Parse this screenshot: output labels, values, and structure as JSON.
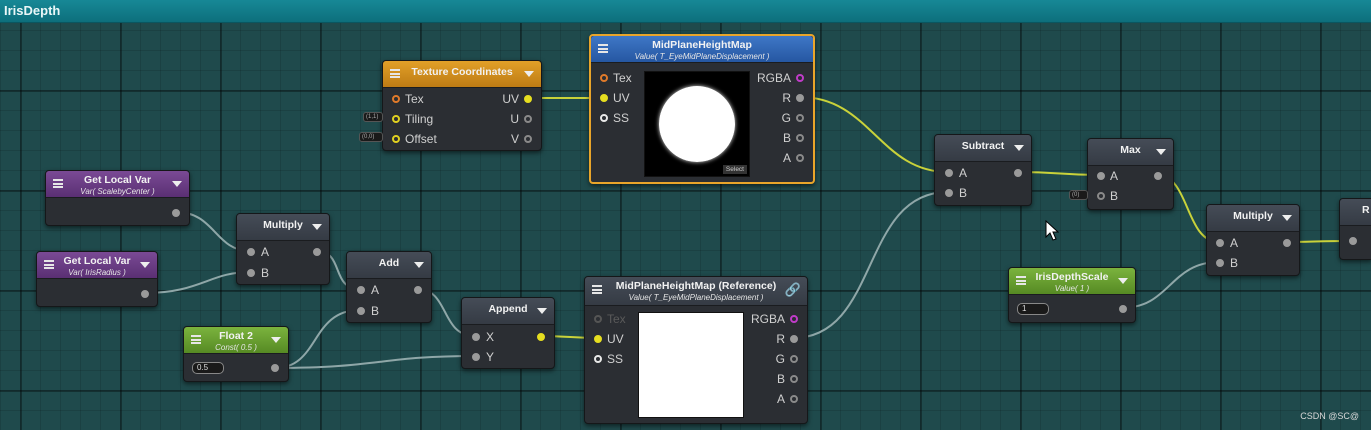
{
  "window": {
    "title": "IrisDepth"
  },
  "nodes": {
    "local_var_1": {
      "title": "Get Local Var",
      "subtitle": "Var( ScalebyCenter )"
    },
    "local_var_2": {
      "title": "Get Local Var",
      "subtitle": "Var( IrisRadius )"
    },
    "multiply_1": {
      "title": "Multiply",
      "input_a": "A",
      "input_b": "B"
    },
    "add": {
      "title": "Add",
      "input_a": "A",
      "input_b": "B"
    },
    "float2": {
      "title": "Float 2",
      "subtitle": "Const( 0.5 )",
      "value": "0.5"
    },
    "append": {
      "title": "Append",
      "input_x": "X",
      "input_y": "Y"
    },
    "texcoords": {
      "title": "Texture Coordinates",
      "in_tex": "Tex",
      "in_tiling": "Tiling",
      "in_offset": "Offset",
      "out_uv": "UV",
      "out_u": "U",
      "out_v": "V",
      "tiling_hint": "(1,1)",
      "offset_hint": "(0,0)"
    },
    "midplane": {
      "title": "MidPlaneHeightMap",
      "subtitle": "Value( T_EyeMidPlaneDisplacement )",
      "in_tex": "Tex",
      "in_uv": "UV",
      "in_ss": "SS",
      "out_rgba": "RGBA",
      "out_r": "R",
      "out_g": "G",
      "out_b": "B",
      "out_a": "A",
      "select": "Select"
    },
    "midplane_ref": {
      "title": "MidPlaneHeightMap (Reference)",
      "subtitle": "Value( T_EyeMidPlaneDisplacement )",
      "in_tex": "Tex",
      "in_uv": "UV",
      "in_ss": "SS",
      "out_rgba": "RGBA",
      "out_r": "R",
      "out_g": "G",
      "out_b": "B",
      "out_a": "A"
    },
    "subtract": {
      "title": "Subtract",
      "input_a": "A",
      "input_b": "B"
    },
    "max": {
      "title": "Max",
      "input_a": "A",
      "input_b": "B",
      "b_hint": "(0)"
    },
    "iris_depth_scale": {
      "title": "IrisDepthScale",
      "subtitle": "Value( 1 )",
      "value": "1"
    },
    "multiply_2": {
      "title": "Multiply",
      "input_a": "A",
      "input_b": "B"
    },
    "partial": {
      "title": "R"
    }
  },
  "watermark": "CSDN @SC@",
  "colors": {
    "title_bar": "#0d6f7c",
    "selected_border": "#e9a52a",
    "wire_yellow": "#c9d23a",
    "wire_gray": "#8fa7a8"
  }
}
